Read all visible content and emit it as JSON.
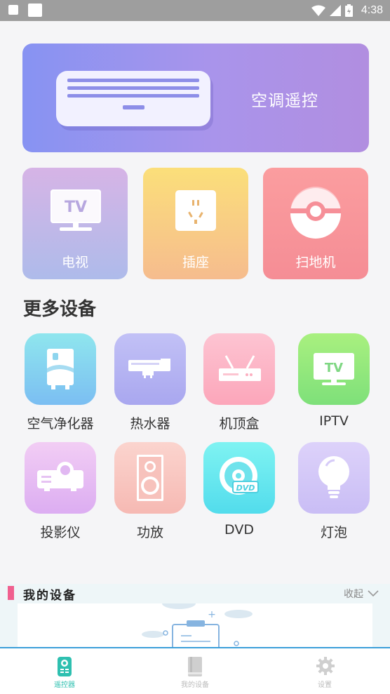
{
  "status_bar": {
    "time": "4:38"
  },
  "banner": {
    "title": "空调遥控"
  },
  "quick_cards": [
    {
      "label": "电视",
      "icon": "tv-icon"
    },
    {
      "label": "插座",
      "icon": "socket-icon"
    },
    {
      "label": "扫地机",
      "icon": "robot-vacuum-icon"
    }
  ],
  "more_devices": {
    "title": "更多设备",
    "items": [
      {
        "label": "空气净化器",
        "icon": "air-purifier-icon"
      },
      {
        "label": "热水器",
        "icon": "water-heater-icon"
      },
      {
        "label": "机顶盒",
        "icon": "set-top-box-icon"
      },
      {
        "label": "IPTV",
        "icon": "iptv-icon"
      },
      {
        "label": "投影仪",
        "icon": "projector-icon"
      },
      {
        "label": "功放",
        "icon": "amplifier-icon"
      },
      {
        "label": "DVD",
        "icon": "dvd-icon"
      },
      {
        "label": "灯泡",
        "icon": "light-bulb-icon"
      }
    ]
  },
  "my_devices": {
    "title": "我的设备",
    "toggle_label": "收起"
  },
  "tabs": [
    {
      "label": "遥控器",
      "active": true,
      "icon": "remote-icon"
    },
    {
      "label": "我的设备",
      "active": false,
      "icon": "book-icon"
    },
    {
      "label": "设置",
      "active": false,
      "icon": "gear-icon"
    }
  ],
  "colors": {
    "accent": "#2ec0b0",
    "section_marker": "#f0608f",
    "tabbar_border": "#3c9fd9"
  }
}
